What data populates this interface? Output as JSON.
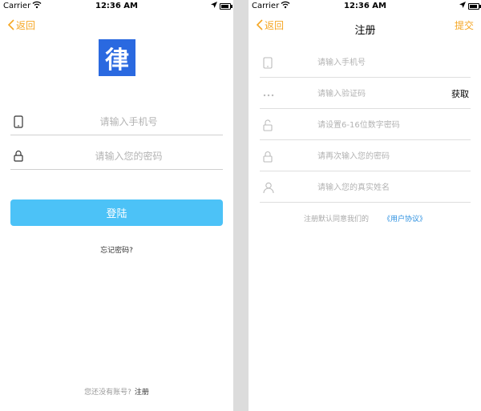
{
  "status_bar": {
    "carrier": "Carrier",
    "time": "12:36 AM",
    "battery_level": 0.9
  },
  "login": {
    "back_label": "返回",
    "logo_char": "律",
    "phone_placeholder": "请输入手机号",
    "password_placeholder": "请输入您的密码",
    "login_button": "登陆",
    "forgot_password": "忘记密码?",
    "no_account_text": "您还没有账号?",
    "register_link": "注册"
  },
  "register": {
    "back_label": "返回",
    "title": "注册",
    "submit_label": "提交",
    "phone_placeholder": "请输入手机号",
    "code_placeholder": "请输入验证码",
    "get_code_label": "获取",
    "password_placeholder": "请设置6-16位数字密码",
    "confirm_placeholder": "请再次输入您的密码",
    "name_placeholder": "请输入您的真实姓名",
    "agreement_text": "注册默认同意我们的",
    "agreement_link": "《用户协议》"
  },
  "colors": {
    "accent": "#f5a623",
    "primary_button": "#4cc2f7",
    "logo_bg": "#2a69e0",
    "link": "#2a8fe0"
  },
  "icons": [
    "wifi-icon",
    "location-icon",
    "battery-icon",
    "back-chevron-icon",
    "phone-icon",
    "lock-icon",
    "dots-icon",
    "lock-open-icon",
    "user-icon"
  ]
}
